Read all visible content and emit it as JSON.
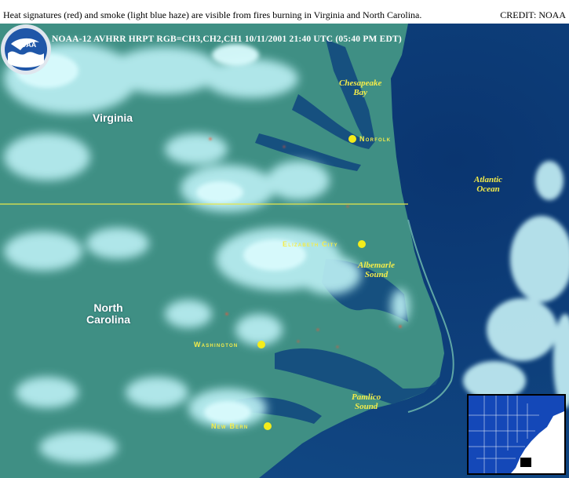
{
  "caption": "Heat signatures (red) and smoke (light blue haze) are visible from fires burning in Virginia and North Carolina.",
  "credit": "CREDIT: NOAA",
  "header": "NOAA-12 AVHRR HRPT  RGB=CH3,CH2,CH1  10/11/2001  21:40 UTC  (05:40 PM EDT)",
  "logo": {
    "text": "NOAA",
    "icon": "noaa-seal-icon"
  },
  "states": [
    {
      "id": "virginia",
      "name": "Virginia"
    },
    {
      "id": "north-carolina",
      "name": "North\nCarolina"
    }
  ],
  "water_bodies": [
    {
      "id": "chesapeake-bay",
      "name": "Chesapeake\nBay"
    },
    {
      "id": "atlantic-ocean",
      "name": "Atlantic\nOcean"
    },
    {
      "id": "albemarle-sound",
      "name": "Albemarle\nSound"
    },
    {
      "id": "pamlico-sound",
      "name": "Pamlico\nSound"
    }
  ],
  "cities": [
    {
      "id": "norfolk",
      "name": "Norfolk"
    },
    {
      "id": "elizabeth-city",
      "name": "Elizabeth City"
    },
    {
      "id": "washington",
      "name": "Washington"
    },
    {
      "id": "new-bern",
      "name": "New Bern"
    }
  ],
  "colors": {
    "land": "#3f8f84",
    "ocean": "#0d3e78",
    "cloud": "#b9eef2",
    "label_yellow": "#f4ec4a",
    "border_line": "#e8e64a",
    "fire": "#ff5030"
  }
}
